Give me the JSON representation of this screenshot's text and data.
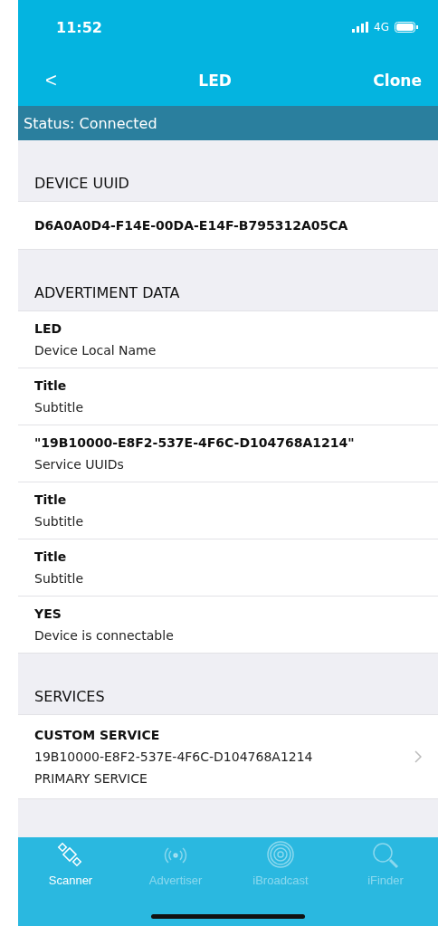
{
  "status_bar": {
    "time": "11:52",
    "network": "4G"
  },
  "nav": {
    "back": "<",
    "title": "LED",
    "action": "Clone"
  },
  "connection_status": "Status: Connected",
  "sections": [
    {
      "header": "DEVICE UUID",
      "rows": [
        {
          "kind": "single",
          "title": "D6A0A0D4-F14E-00DA-E14F-B795312A05CA"
        }
      ]
    },
    {
      "header": "ADVERTIMENT DATA",
      "rows": [
        {
          "kind": "pair",
          "title": "LED",
          "subtitle": "Device Local Name"
        },
        {
          "kind": "pair",
          "title": "Title",
          "subtitle": "Subtitle"
        },
        {
          "kind": "pair",
          "title": "\"19B10000-E8F2-537E-4F6C-D104768A1214\"",
          "subtitle": "Service UUIDs"
        },
        {
          "kind": "pair",
          "title": "Title",
          "subtitle": "Subtitle"
        },
        {
          "kind": "pair",
          "title": "Title",
          "subtitle": "Subtitle"
        },
        {
          "kind": "pair",
          "title": "YES",
          "subtitle": "Device is connectable"
        }
      ]
    },
    {
      "header": "SERVICES",
      "rows": [
        {
          "kind": "service",
          "title": "CUSTOM SERVICE",
          "uuid": "19B10000-E8F2-537E-4F6C-D104768A1214",
          "subtitle": "PRIMARY SERVICE"
        }
      ]
    }
  ],
  "tabs": [
    {
      "label": "Scanner",
      "selected": true
    },
    {
      "label": "Advertiser",
      "selected": false
    },
    {
      "label": "iBroadcast",
      "selected": false
    },
    {
      "label": "iFinder",
      "selected": false
    }
  ]
}
